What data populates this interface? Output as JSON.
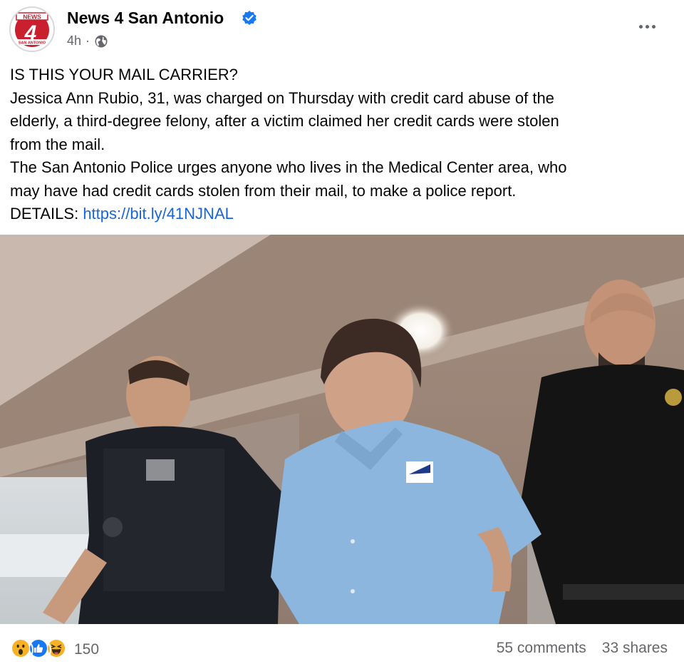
{
  "post": {
    "page_name": "News 4 San Antonio",
    "timestamp": "4h",
    "privacy_icon": "globe-icon",
    "avatar_text_top": "NEWS",
    "avatar_text_number": "4",
    "avatar_text_bottom": "SAN ANTONIO",
    "lines": [
      "IS THIS YOUR MAIL CARRIER?",
      "Jessica Ann Rubio, 31, was charged on Thursday with credit card abuse of the",
      "elderly, a third-degree felony, after a victim claimed her credit cards were stolen",
      "from the mail.",
      "The San Antonio Police urges anyone who lives in the Medical Center area, who",
      "may have had credit cards stolen from their mail, to make a police report."
    ],
    "details_label": "DETAILS:",
    "details_link": "https://bit.ly/41NJNAL"
  },
  "footer": {
    "reaction_count": "150",
    "comments": "55 comments",
    "shares": "33 shares"
  },
  "colors": {
    "link": "#1a66d6",
    "verified": "#1877f2",
    "secondary_text": "#65676b",
    "avatar_red": "#c8202f"
  }
}
